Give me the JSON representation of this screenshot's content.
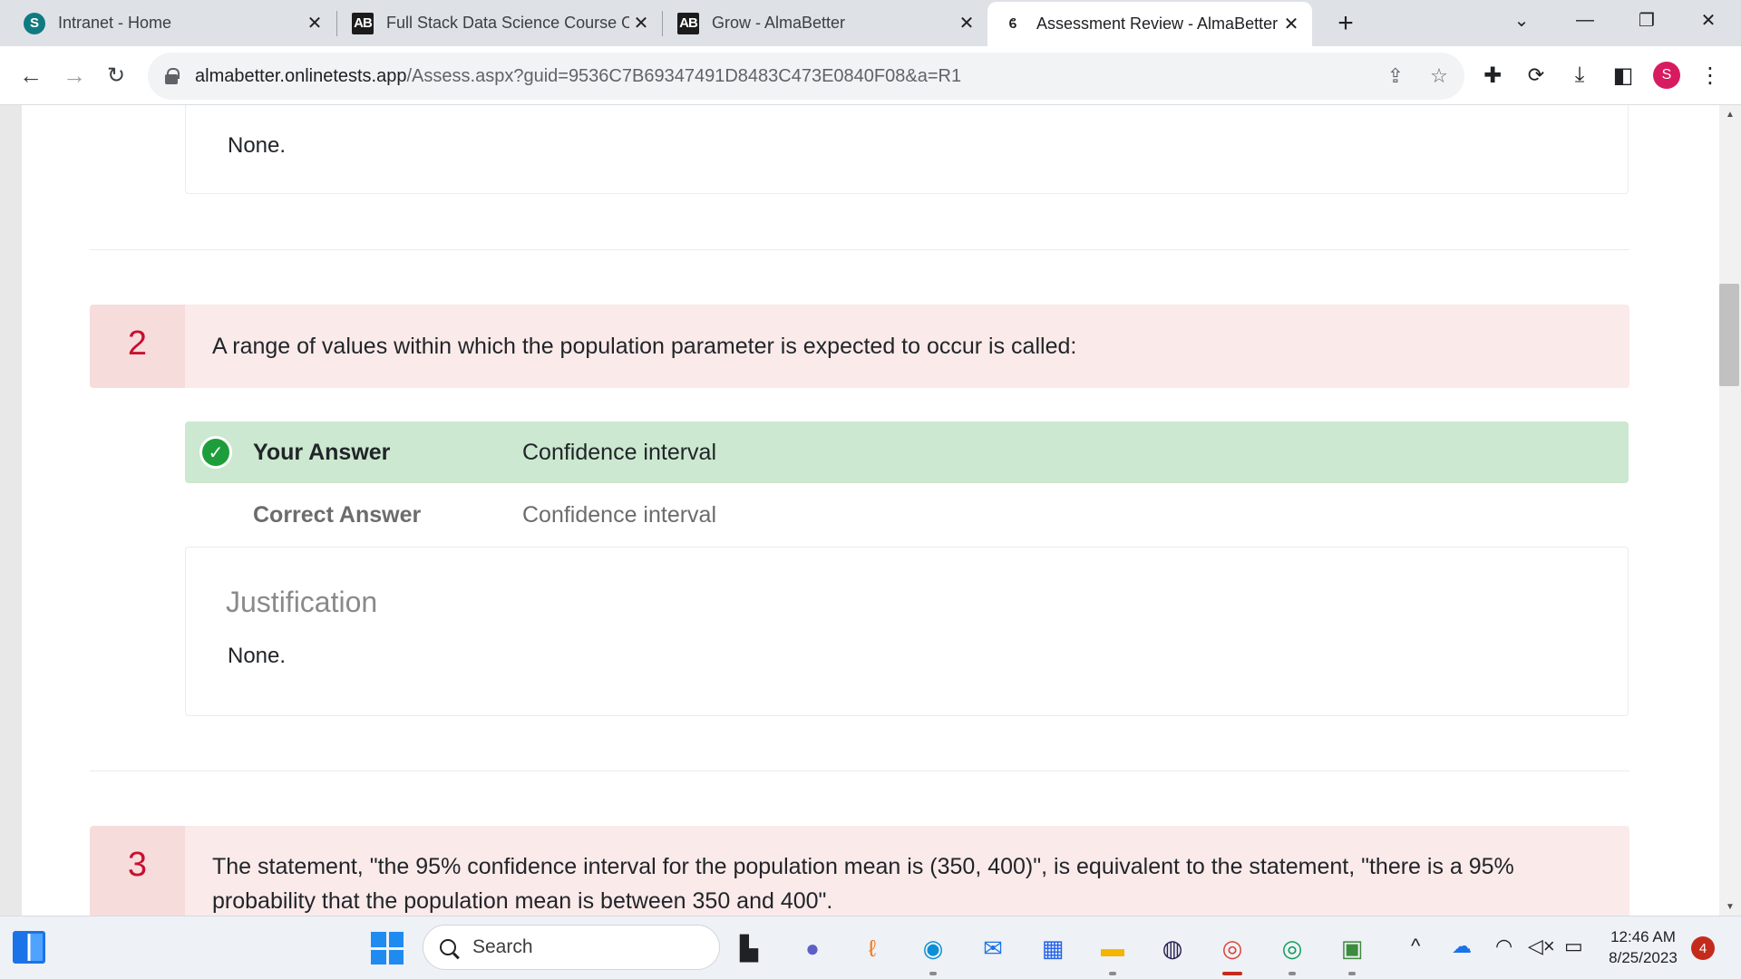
{
  "browser": {
    "tabs": [
      {
        "title": "Intranet - Home",
        "favicon": "sharepoint-icon",
        "active": false
      },
      {
        "title": "Full Stack Data Science Course O",
        "favicon": "almabetter-icon",
        "active": false
      },
      {
        "title": "Grow - AlmaBetter",
        "favicon": "almabetter-icon",
        "active": false
      },
      {
        "title": "Assessment Review - AlmaBetter",
        "favicon": "almabetter-b-icon",
        "active": true
      }
    ],
    "url_host": "almabetter.onlinetests.app",
    "url_path": "/Assess.aspx?guid=9536C7B69347491D8483C473E0840F08&a=R1",
    "profile_initial": "S"
  },
  "content": {
    "prev_justification": "None.",
    "question2": {
      "number": "2",
      "text": "A range of values within which the population parameter is expected to occur is called:",
      "your_answer_label": "Your Answer",
      "your_answer_value": "Confidence interval",
      "correct_answer_label": "Correct Answer",
      "correct_answer_value": "Confidence interval",
      "justification_title": "Justification",
      "justification_text": "None."
    },
    "question3": {
      "number": "3",
      "text": "The statement, \"the 95% confidence interval for the population mean is (350, 400)\", is equivalent to the statement, \"there is a 95% probability that the population mean is between 350 and 400\"."
    }
  },
  "taskbar": {
    "search_placeholder": "Search",
    "time": "12:46 AM",
    "date": "8/25/2023",
    "notifications": "4"
  },
  "colors": {
    "question_bg": "#fbeaea",
    "question_number": "#c8102e",
    "correct_answer_bg": "#cce8d0",
    "check_green": "#1e9e3a"
  }
}
